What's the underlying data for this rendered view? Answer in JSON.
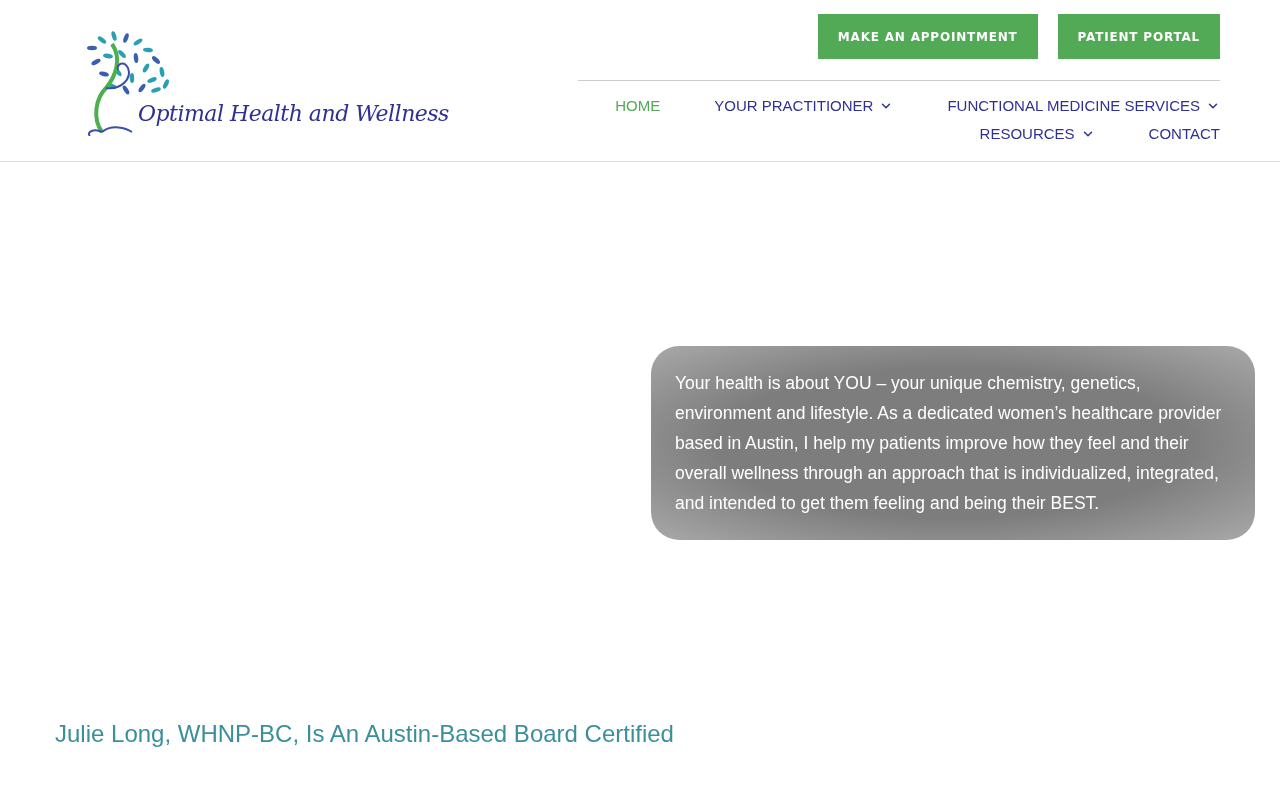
{
  "logo": {
    "text": "Optimal Health and Wellness"
  },
  "header_buttons": [
    "MAKE AN APPOINTMENT",
    "PATIENT PORTAL"
  ],
  "nav": [
    {
      "label": "HOME",
      "selected": true,
      "dropdown": false
    },
    {
      "label": "YOUR PRACTITIONER",
      "selected": false,
      "dropdown": true
    },
    {
      "label": "FUNCTIONAL MEDICINE SERVICES",
      "selected": false,
      "dropdown": true
    },
    {
      "label": "RESOURCES",
      "selected": false,
      "dropdown": true
    },
    {
      "label": "CONTACT",
      "selected": false,
      "dropdown": false
    }
  ],
  "hero": {
    "text": "Your health is about YOU – your unique chemistry, genetics, environment and lifestyle. As a dedicated women’s healthcare provider based in Austin, I help my patients improve how they feel and their overall wellness through an approach that is individualized, integrated, and intended to get them feeling and being their BEST."
  },
  "heading": "Julie Long, WHNP-BC, Is An Austin-Based Board Certified"
}
